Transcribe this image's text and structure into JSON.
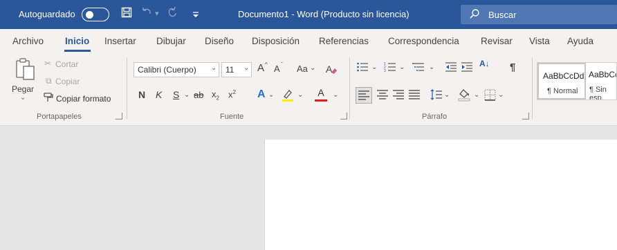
{
  "titlebar": {
    "autosave_label": "Autoguardado",
    "document_title": "Documento1  -  Word (Producto sin licencia)",
    "search_label": "Buscar",
    "colors": {
      "background": "#2b579a",
      "search_bg": "#4f77b4"
    }
  },
  "quick_access": [
    {
      "icon": "save-icon",
      "glyph": "🖫"
    },
    {
      "icon": "undo-icon",
      "glyph": "↶"
    },
    {
      "icon": "undo-dropdown-icon",
      "glyph": "▾"
    },
    {
      "icon": "redo-icon",
      "glyph": "↻"
    },
    {
      "icon": "customize-toolbar-icon",
      "glyph": "≂"
    }
  ],
  "tabs": [
    "Archivo",
    "Inicio",
    "Insertar",
    "Dibujar",
    "Diseño",
    "Disposición",
    "Referencias",
    "Correspondencia",
    "Revisar",
    "Vista",
    "Ayuda"
  ],
  "active_tab": "Inicio",
  "clipboard": {
    "paste_label": "Pegar",
    "cut_label": "Cortar",
    "copy_label": "Copiar",
    "format_painter_label": "Copiar formato",
    "group_label": "Portapapeles"
  },
  "font": {
    "font_name": "Calibri (Cuerpo)",
    "font_size": "11",
    "bold": "N",
    "italic": "K",
    "underline": "S",
    "strikethrough": "ab",
    "subscript": "x",
    "subscript_mark": "2",
    "superscript": "x",
    "superscript_mark": "2",
    "grow": "A",
    "shrink": "A",
    "change_case": "Aa",
    "text_effects": "A",
    "font_color": "A",
    "group_label": "Fuente",
    "colors": {
      "highlight": "#f6ef00",
      "font_color": "#e01a1a",
      "effects": "#2f6fd1"
    }
  },
  "paragraph": {
    "sort": "A↓",
    "show_marks": "¶",
    "group_label": "Párrafo"
  },
  "styles": {
    "items": [
      {
        "sample": "AaBbCcDd",
        "name": "¶ Normal"
      },
      {
        "sample": "AaBbCcDd",
        "name": "¶ Sin esp."
      }
    ]
  }
}
